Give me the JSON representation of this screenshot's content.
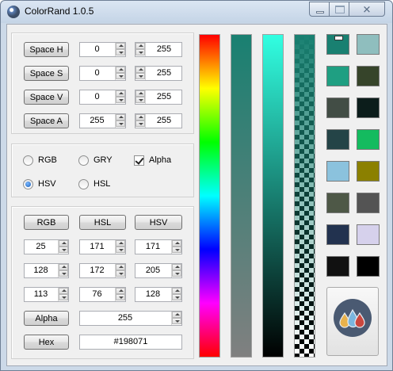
{
  "window": {
    "title": "ColorRand 1.0.5",
    "icons": {
      "app": "colorrand-app-icon",
      "minimize": "minimize-icon",
      "maximize": "maximize-icon",
      "close": "close-icon"
    },
    "close_glyph": "✕"
  },
  "spaces": [
    {
      "label": "Space H",
      "min": "0",
      "max": "255"
    },
    {
      "label": "Space S",
      "min": "0",
      "max": "255"
    },
    {
      "label": "Space V",
      "min": "0",
      "max": "255"
    },
    {
      "label": "Space A",
      "min": "255",
      "max": "255"
    }
  ],
  "options": {
    "rgb": {
      "label": "RGB",
      "selected": false
    },
    "gry": {
      "label": "GRY",
      "selected": false
    },
    "alpha": {
      "label": "Alpha",
      "checked": true
    },
    "hsv": {
      "label": "HSV",
      "selected": true
    },
    "hsl": {
      "label": "HSL",
      "selected": false
    }
  },
  "models": {
    "headers": [
      "RGB",
      "HSL",
      "HSV"
    ],
    "rgb": [
      "25",
      "128",
      "113"
    ],
    "hsl": [
      "171",
      "172",
      "76"
    ],
    "hsv": [
      "171",
      "205",
      "128"
    ]
  },
  "alpha": {
    "label": "Alpha",
    "value": "255"
  },
  "hex": {
    "label": "Hex",
    "value": "#198071"
  },
  "colors": {
    "current": "#198071",
    "hue_gradient": [
      "#ff0000",
      "#ffff00",
      "#00ff00",
      "#00ffff",
      "#0000ff",
      "#ff00ff",
      "#ff0000"
    ],
    "saturation_gradient": [
      "#198071",
      "#808080"
    ],
    "value_gradient": [
      "#31ffe2",
      "#000000"
    ]
  },
  "swatches": [
    "#198071",
    "#8fbebe",
    "#1f9f82",
    "#36442a",
    "#424d45",
    "#0c1d1b",
    "#244447",
    "#14bb5f",
    "#8bc2dd",
    "#8b8000",
    "#4e5847",
    "#545454",
    "#22324f",
    "#d6d1ec",
    "#111111",
    "#000000"
  ],
  "logo": {
    "icon": "colorrand-logo-icon",
    "drop_colors": [
      "#e9b24c",
      "#7ab6de",
      "#c9473e"
    ]
  }
}
